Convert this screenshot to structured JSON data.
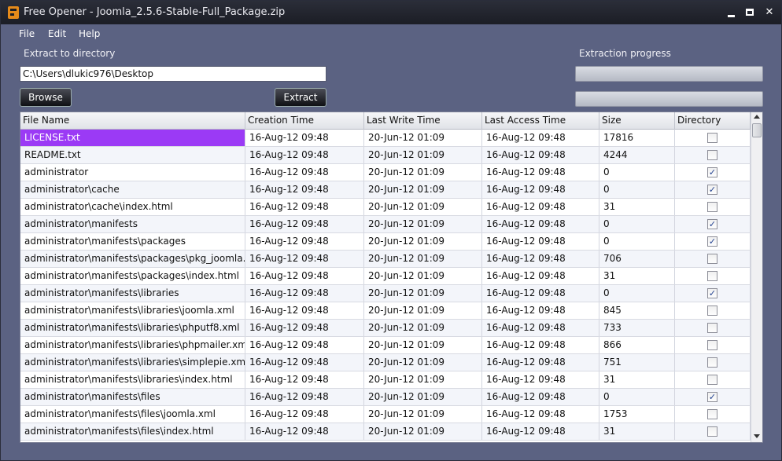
{
  "window": {
    "title": "Free Opener - Joomla_2.5.6-Stable-Full_Package.zip",
    "icon": "free-opener-app-icon"
  },
  "menu": {
    "file": "File",
    "edit": "Edit",
    "help": "Help"
  },
  "extract": {
    "label": "Extract to directory",
    "path_value": "C:\\Users\\dlukic976\\Desktop",
    "browse_label": "Browse",
    "extract_label": "Extract"
  },
  "progress": {
    "label": "Extraction progress",
    "bar1": 0,
    "bar2": 0
  },
  "table": {
    "columns": [
      "File Name",
      "Creation Time",
      "Last Write Time",
      "Last Access Time",
      "Size",
      "Directory"
    ],
    "selected_color": "#9b3af5",
    "rows": [
      {
        "name": "LICENSE.txt",
        "created": "16-Aug-12 09:48",
        "written": "20-Jun-12 01:09",
        "accessed": "16-Aug-12 09:48",
        "size": "17816",
        "dir": false
      },
      {
        "name": "README.txt",
        "created": "16-Aug-12 09:48",
        "written": "20-Jun-12 01:09",
        "accessed": "16-Aug-12 09:48",
        "size": "4244",
        "dir": false
      },
      {
        "name": "administrator",
        "created": "16-Aug-12 09:48",
        "written": "20-Jun-12 01:09",
        "accessed": "16-Aug-12 09:48",
        "size": "0",
        "dir": true
      },
      {
        "name": "administrator\\cache",
        "created": "16-Aug-12 09:48",
        "written": "20-Jun-12 01:09",
        "accessed": "16-Aug-12 09:48",
        "size": "0",
        "dir": true
      },
      {
        "name": "administrator\\cache\\index.html",
        "created": "16-Aug-12 09:48",
        "written": "20-Jun-12 01:09",
        "accessed": "16-Aug-12 09:48",
        "size": "31",
        "dir": false
      },
      {
        "name": "administrator\\manifests",
        "created": "16-Aug-12 09:48",
        "written": "20-Jun-12 01:09",
        "accessed": "16-Aug-12 09:48",
        "size": "0",
        "dir": true
      },
      {
        "name": "administrator\\manifests\\packages",
        "created": "16-Aug-12 09:48",
        "written": "20-Jun-12 01:09",
        "accessed": "16-Aug-12 09:48",
        "size": "0",
        "dir": true
      },
      {
        "name": "administrator\\manifests\\packages\\pkg_joomla.xml",
        "created": "16-Aug-12 09:48",
        "written": "20-Jun-12 01:09",
        "accessed": "16-Aug-12 09:48",
        "size": "706",
        "dir": false
      },
      {
        "name": "administrator\\manifests\\packages\\index.html",
        "created": "16-Aug-12 09:48",
        "written": "20-Jun-12 01:09",
        "accessed": "16-Aug-12 09:48",
        "size": "31",
        "dir": false
      },
      {
        "name": "administrator\\manifests\\libraries",
        "created": "16-Aug-12 09:48",
        "written": "20-Jun-12 01:09",
        "accessed": "16-Aug-12 09:48",
        "size": "0",
        "dir": true
      },
      {
        "name": "administrator\\manifests\\libraries\\joomla.xml",
        "created": "16-Aug-12 09:48",
        "written": "20-Jun-12 01:09",
        "accessed": "16-Aug-12 09:48",
        "size": "845",
        "dir": false
      },
      {
        "name": "administrator\\manifests\\libraries\\phputf8.xml",
        "created": "16-Aug-12 09:48",
        "written": "20-Jun-12 01:09",
        "accessed": "16-Aug-12 09:48",
        "size": "733",
        "dir": false
      },
      {
        "name": "administrator\\manifests\\libraries\\phpmailer.xml",
        "created": "16-Aug-12 09:48",
        "written": "20-Jun-12 01:09",
        "accessed": "16-Aug-12 09:48",
        "size": "866",
        "dir": false
      },
      {
        "name": "administrator\\manifests\\libraries\\simplepie.xml",
        "created": "16-Aug-12 09:48",
        "written": "20-Jun-12 01:09",
        "accessed": "16-Aug-12 09:48",
        "size": "751",
        "dir": false
      },
      {
        "name": "administrator\\manifests\\libraries\\index.html",
        "created": "16-Aug-12 09:48",
        "written": "20-Jun-12 01:09",
        "accessed": "16-Aug-12 09:48",
        "size": "31",
        "dir": false
      },
      {
        "name": "administrator\\manifests\\files",
        "created": "16-Aug-12 09:48",
        "written": "20-Jun-12 01:09",
        "accessed": "16-Aug-12 09:48",
        "size": "0",
        "dir": true
      },
      {
        "name": "administrator\\manifests\\files\\joomla.xml",
        "created": "16-Aug-12 09:48",
        "written": "20-Jun-12 01:09",
        "accessed": "16-Aug-12 09:48",
        "size": "1753",
        "dir": false
      },
      {
        "name": "administrator\\manifests\\files\\index.html",
        "created": "16-Aug-12 09:48",
        "written": "20-Jun-12 01:09",
        "accessed": "16-Aug-12 09:48",
        "size": "31",
        "dir": false
      }
    ]
  }
}
